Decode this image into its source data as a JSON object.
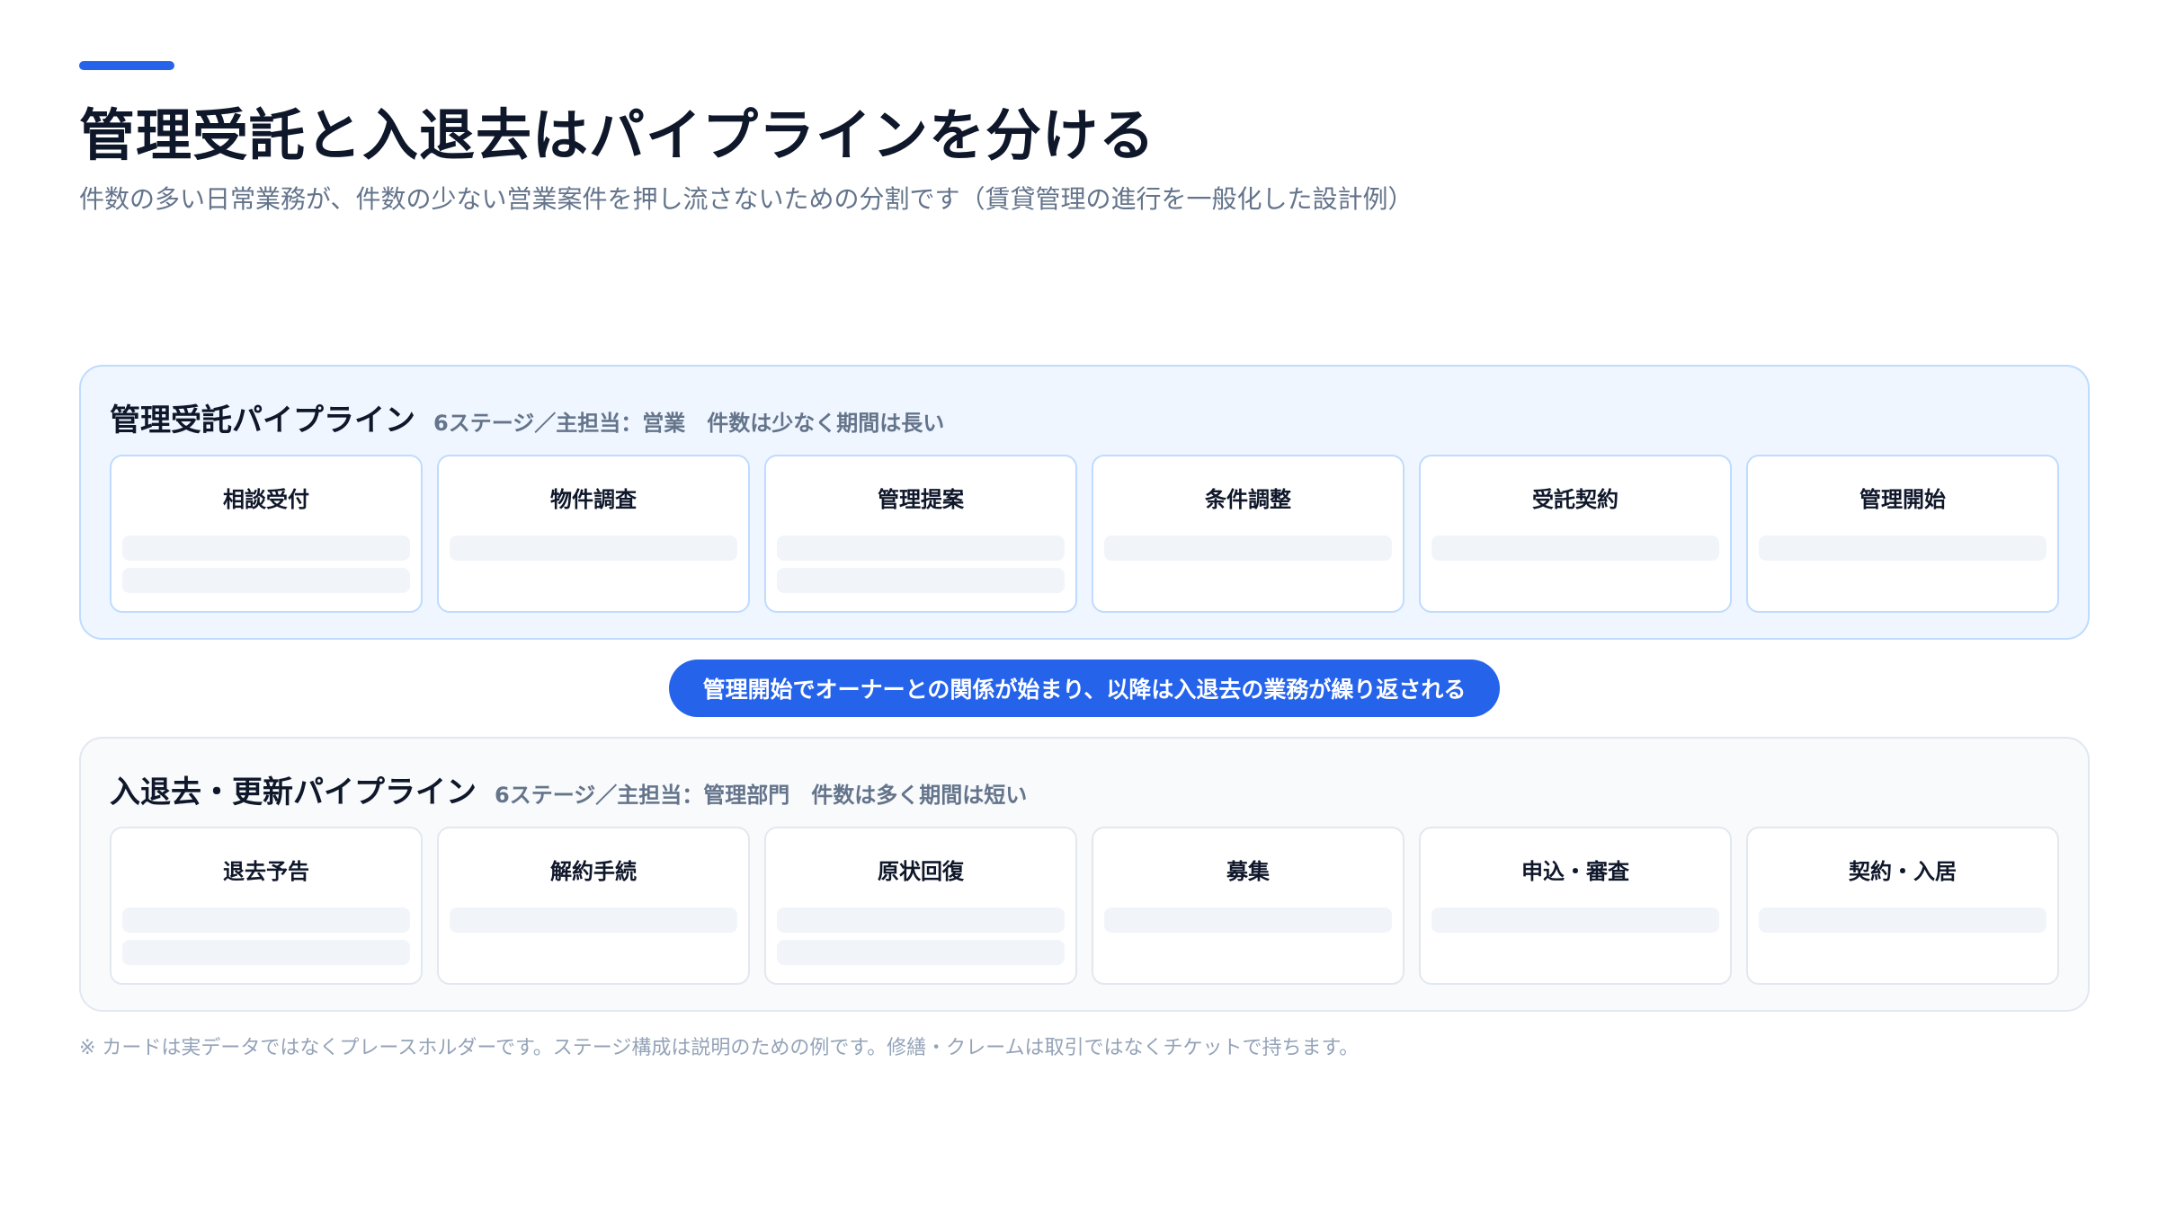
{
  "header": {
    "title": "管理受託と入退去はパイプラインを分ける",
    "subtitle": "件数の多い日常業務が、件数の少ない営業案件を押し流さないための分割です（賃貸管理の進行を一般化した設計例）"
  },
  "pipelines": [
    {
      "title": "管理受託パイプライン",
      "meta": "6ステージ／主担当：営業　件数は少なく期間は長い",
      "stages": [
        {
          "label": "相談受付",
          "placeholder_lines": 2
        },
        {
          "label": "物件調査",
          "placeholder_lines": 1
        },
        {
          "label": "管理提案",
          "placeholder_lines": 2
        },
        {
          "label": "条件調整",
          "placeholder_lines": 1
        },
        {
          "label": "受託契約",
          "placeholder_lines": 1
        },
        {
          "label": "管理開始",
          "placeholder_lines": 1
        }
      ]
    },
    {
      "title": "入退去・更新パイプライン",
      "meta": "6ステージ／主担当：管理部門　件数は多く期間は短い",
      "stages": [
        {
          "label": "退去予告",
          "placeholder_lines": 2
        },
        {
          "label": "解約手続",
          "placeholder_lines": 1
        },
        {
          "label": "原状回復",
          "placeholder_lines": 2
        },
        {
          "label": "募集",
          "placeholder_lines": 1
        },
        {
          "label": "申込・審査",
          "placeholder_lines": 1
        },
        {
          "label": "契約・入居",
          "placeholder_lines": 1
        }
      ]
    }
  ],
  "connector": {
    "text": "管理開始でオーナーとの関係が始まり、以降は入退去の業務が繰り返される"
  },
  "footnote": "※ カードは実データではなくプレースホルダーです。ステージ構成は説明のための例です。修繕・クレームは取引ではなくチケットで持ちます。",
  "colors": {
    "accent": "#2563eb",
    "pipeline_1_bg": "#eff6ff",
    "pipeline_2_bg": "#f8fafc",
    "placeholder": "#f1f5f9"
  }
}
